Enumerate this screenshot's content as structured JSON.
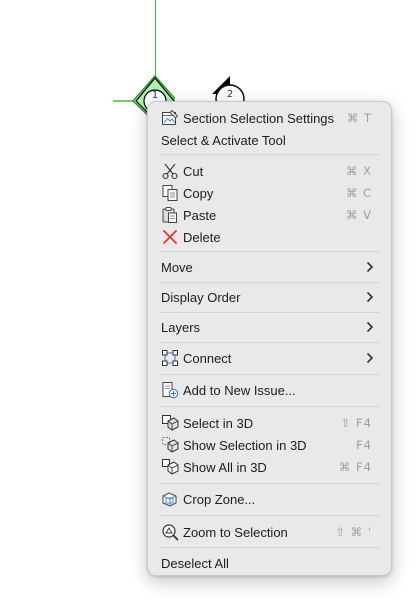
{
  "canvas": {
    "markers": [
      {
        "number": "1"
      },
      {
        "number": "2"
      }
    ]
  },
  "menu": {
    "section_selection_settings": {
      "label": "Section Selection Settings",
      "shortcut": "⌘ T",
      "icon": "section-settings-icon"
    },
    "select_activate_tool": {
      "label": "Select & Activate Tool"
    },
    "cut": {
      "label": "Cut",
      "shortcut": "⌘ X",
      "icon": "scissors-icon"
    },
    "copy": {
      "label": "Copy",
      "shortcut": "⌘ C",
      "icon": "copy-icon"
    },
    "paste": {
      "label": "Paste",
      "shortcut": "⌘ V",
      "icon": "clipboard-icon"
    },
    "delete": {
      "label": "Delete",
      "icon": "delete-x-icon"
    },
    "move": {
      "label": "Move"
    },
    "display_order": {
      "label": "Display Order"
    },
    "layers": {
      "label": "Layers"
    },
    "connect": {
      "label": "Connect",
      "icon": "connect-icon"
    },
    "add_to_new_issue": {
      "label": "Add to New Issue...",
      "icon": "add-issue-icon"
    },
    "select_in_3d": {
      "label": "Select in 3D",
      "shortcut": "⇧ F4",
      "icon": "select-3d-icon"
    },
    "show_selection_in_3d": {
      "label": "Show Selection in 3D",
      "shortcut": "F4",
      "icon": "show-selection-3d-icon"
    },
    "show_all_in_3d": {
      "label": "Show All in 3D",
      "shortcut": "⌘ F4",
      "icon": "show-all-3d-icon"
    },
    "crop_zone": {
      "label": "Crop Zone...",
      "icon": "crop-zone-icon"
    },
    "zoom_to_selection": {
      "label": "Zoom to Selection",
      "shortcut": "⇧ ⌘ '",
      "icon": "zoom-selection-icon"
    },
    "deselect_all": {
      "label": "Deselect All"
    }
  },
  "colors": {
    "guide_green": "#3bbf3b",
    "marker_text_blue": "#1a2bd6",
    "delete_red": "#e2352b",
    "menu_background": "#e9e9e9",
    "shortcut_gray": "#9d9d9d"
  }
}
